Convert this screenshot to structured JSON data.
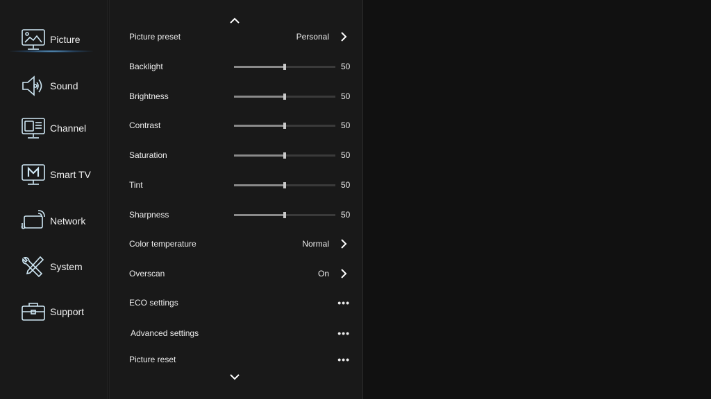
{
  "sidebar": {
    "items": [
      {
        "label": "Picture",
        "icon": "picture-icon",
        "active": true
      },
      {
        "label": "Sound",
        "icon": "speaker-icon"
      },
      {
        "label": "Channel",
        "icon": "tv-channel-icon"
      },
      {
        "label": "Smart TV",
        "icon": "smart-tv-icon"
      },
      {
        "label": "Network",
        "icon": "network-icon"
      },
      {
        "label": "System",
        "icon": "tools-icon"
      },
      {
        "label": "Support",
        "icon": "toolbox-icon"
      }
    ]
  },
  "settings": [
    {
      "name": "Picture preset",
      "value": "Personal",
      "type": "option"
    },
    {
      "name": "Backlight",
      "value": "50",
      "type": "slider",
      "level": 50
    },
    {
      "name": "Brightness",
      "value": "50",
      "type": "slider",
      "level": 50
    },
    {
      "name": "Contrast",
      "value": "50",
      "type": "slider",
      "level": 50
    },
    {
      "name": "Saturation",
      "value": "50",
      "type": "slider",
      "level": 50
    },
    {
      "name": "Tint",
      "value": "50",
      "type": "slider",
      "level": 50
    },
    {
      "name": "Sharpness",
      "value": "50",
      "type": "slider",
      "level": 50
    },
    {
      "name": "Color temperature",
      "value": "Normal",
      "type": "option"
    },
    {
      "name": "Overscan",
      "value": "On",
      "type": "option"
    },
    {
      "name": "ECO settings",
      "value": "•••",
      "type": "more"
    },
    {
      "name": "Advanced settings",
      "value": "•••",
      "type": "more"
    },
    {
      "name": "Picture reset",
      "value": "•••",
      "type": "more"
    }
  ],
  "colors": {
    "glow": "#78c8ff",
    "background": "#111111",
    "panel": "#191919"
  }
}
